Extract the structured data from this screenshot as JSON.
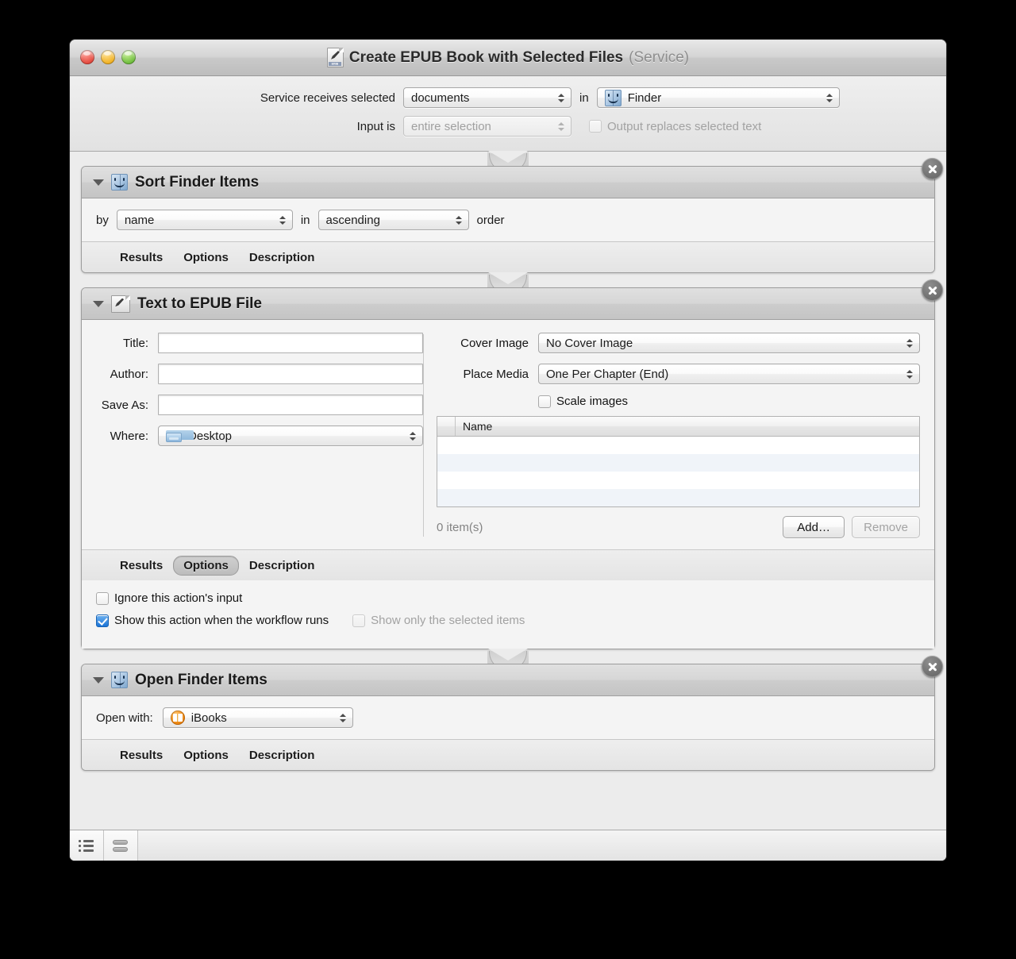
{
  "window": {
    "title": "Create EPUB Book with Selected Files",
    "title_suffix": "(Service)",
    "doc_icon": "epub-document-icon"
  },
  "service_header": {
    "receives_label": "Service receives selected",
    "receives_value": "documents",
    "in_label": "in",
    "app_value": "Finder",
    "app_icon": "finder-icon",
    "input_label": "Input is",
    "input_value": "entire selection",
    "output_checkbox_label": "Output replaces selected text",
    "output_checkbox_checked": false,
    "output_checkbox_enabled": false
  },
  "actions": [
    {
      "id": "sort-finder-items",
      "title": "Sort Finder Items",
      "icon": "finder-icon",
      "by_label": "by",
      "by_value": "name",
      "in_label": "in",
      "order_value": "ascending",
      "order_label": "order",
      "tabs": [
        "Results",
        "Options",
        "Description"
      ],
      "selected_tab": null
    },
    {
      "id": "text-to-epub-file",
      "title": "Text to EPUB File",
      "icon": "text-document-pen-icon",
      "left_fields": [
        {
          "label": "Title:",
          "value": "",
          "type": "text"
        },
        {
          "label": "Author:",
          "value": "",
          "type": "text"
        },
        {
          "label": "Save As:",
          "value": "",
          "type": "text"
        }
      ],
      "where_label": "Where:",
      "where_value": "Desktop",
      "where_icon": "folder-icon",
      "cover_image_label": "Cover Image",
      "cover_image_value": "No Cover Image",
      "place_media_label": "Place Media",
      "place_media_value": "One Per Chapter (End)",
      "scale_images_label": "Scale images",
      "scale_images_checked": false,
      "table": {
        "columns": [
          "Name"
        ],
        "rows": [],
        "empty_row_count": 4
      },
      "item_count_text": "0 item(s)",
      "add_button": "Add…",
      "remove_button": "Remove",
      "remove_enabled": false,
      "tabs": [
        "Results",
        "Options",
        "Description"
      ],
      "selected_tab": "Options",
      "options": {
        "ignore_input_label": "Ignore this action's input",
        "ignore_input_checked": false,
        "show_action_label": "Show this action when the workflow runs",
        "show_action_checked": true,
        "show_selected_label": "Show only the selected items",
        "show_selected_checked": false,
        "show_selected_enabled": false
      }
    },
    {
      "id": "open-finder-items",
      "title": "Open Finder Items",
      "icon": "finder-icon",
      "open_with_label": "Open with:",
      "open_with_value": "iBooks",
      "open_with_icon": "ibooks-icon",
      "tabs": [
        "Results",
        "Options",
        "Description"
      ],
      "selected_tab": null
    }
  ],
  "bottom_bar": {
    "buttons": [
      {
        "name": "list-view",
        "icon": "list-view-icon"
      },
      {
        "name": "flow-view",
        "icon": "flow-view-icon"
      }
    ]
  },
  "colors": {
    "window_bg": "#ececec",
    "action_header": "#cfcfcf",
    "accent_checkbox": "#1a74d6",
    "table_stripe": "#f0f4f9"
  }
}
